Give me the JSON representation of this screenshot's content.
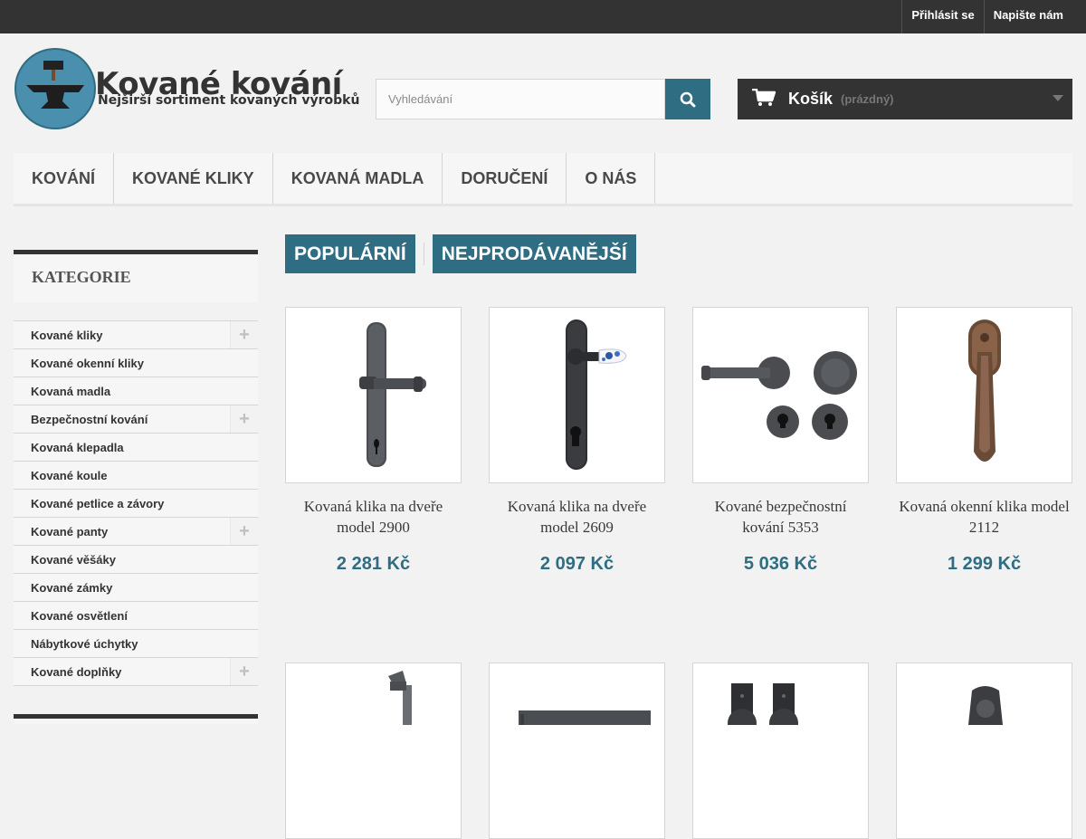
{
  "topbar": {
    "login": "Přihlásit se",
    "contact": "Napište nám"
  },
  "logo": {
    "title": "Kované kování",
    "subtitle": "Nejširší sortiment kovaných výrobků"
  },
  "search": {
    "placeholder": "Vyhledávání"
  },
  "cart": {
    "label": "Košík",
    "status": "(prázdný)"
  },
  "nav": [
    "Kování",
    "Kované kliky",
    "Kovaná madla",
    "Doručení",
    "O nás"
  ],
  "sidebar": {
    "title": "Kategorie",
    "items": [
      {
        "label": "Kované kliky",
        "expandable": true
      },
      {
        "label": "Kované okenní kliky",
        "expandable": false
      },
      {
        "label": "Kovaná madla",
        "expandable": false
      },
      {
        "label": "Bezpečnostní kování",
        "expandable": true
      },
      {
        "label": "Kovaná klepadla",
        "expandable": false
      },
      {
        "label": "Kované koule",
        "expandable": false
      },
      {
        "label": "Kované petlice a závory",
        "expandable": false
      },
      {
        "label": "Kované panty",
        "expandable": true
      },
      {
        "label": "Kované věšáky",
        "expandable": false
      },
      {
        "label": "Kované zámky",
        "expandable": false
      },
      {
        "label": "Kované osvětlení",
        "expandable": false
      },
      {
        "label": "Nábytkové úchytky",
        "expandable": false
      },
      {
        "label": "Kované doplňky",
        "expandable": true
      }
    ]
  },
  "tabs": [
    "Populární",
    "Nejprodávanější"
  ],
  "products": [
    {
      "name": "Kovaná klika na dveře model 2900",
      "price": "2 281 Kč"
    },
    {
      "name": "Kovaná klika na dveře model 2609",
      "price": "2 097 Kč"
    },
    {
      "name": "Kované bezpečnostní kování 5353",
      "price": "5 036 Kč"
    },
    {
      "name": "Kovaná okenní klika model 2112",
      "price": "1 299 Kč"
    }
  ],
  "colors": {
    "accent": "#2f6d82",
    "dark": "#333333"
  }
}
